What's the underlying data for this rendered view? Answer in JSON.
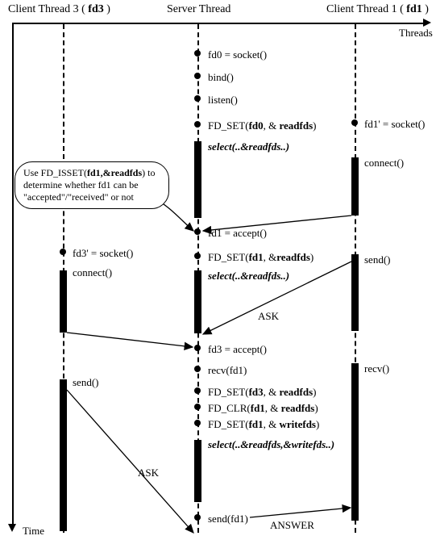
{
  "headers": {
    "c3": {
      "pre": "Client Thread 3 ( ",
      "fd": "fd3",
      "post": " )"
    },
    "srv": "Server Thread",
    "c1": {
      "pre": "Client Thread 1 ( ",
      "fd": "fd1",
      "post": " )"
    }
  },
  "axes": {
    "threads": "Threads",
    "time": "Time"
  },
  "server_steps": {
    "s1": "fd0 = socket()",
    "s2": "bind()",
    "s3": "listen()",
    "s4_a": "FD_SET(",
    "s4_b": "fd0",
    "s4_c": ", & ",
    "s4_d": "readfds",
    "s4_e": ")",
    "sel1": "select(..&readfds..)",
    "s5": "fd1 = accept()",
    "s6_a": "FD_SET(",
    "s6_b": "fd1",
    "s6_c": ", &",
    "s6_d": "readfds",
    "s6_e": ")",
    "sel2": "select(..&readfds..)",
    "s7": "fd3 = accept()",
    "s8": "recv(fd1)",
    "s9_a": "FD_SET(",
    "s9_b": "fd3",
    "s9_c": ", & ",
    "s9_d": "readfds",
    "s9_e": ")",
    "s10_a": "FD_CLR(",
    "s10_b": "fd1",
    "s10_c": ", & ",
    "s10_d": "readfds",
    "s10_e": ")",
    "s11_a": "FD_SET(",
    "s11_b": "fd1",
    "s11_c": ", & ",
    "s11_d": "writefds",
    "s11_e": ")",
    "sel3": "select(..&readfds,&writefds..)",
    "s12": "send(fd1)"
  },
  "client1": {
    "c1a": "fd1' = socket()",
    "c1b": "connect()",
    "c1c": "send()",
    "c1d": "recv()"
  },
  "client3": {
    "c3a": "fd3' = socket()",
    "c3b": "connect()",
    "c3c": "send()"
  },
  "msgs": {
    "ask": "ASK",
    "answer": "ANSWER"
  },
  "note": {
    "l1a": "Use FD_ISSET(",
    "l1b": "fd1,&readfds",
    "l1c": ") to",
    "l2": "determine whether fd1 can be",
    "l3": "\"accepted\"/\"received\" or not"
  }
}
